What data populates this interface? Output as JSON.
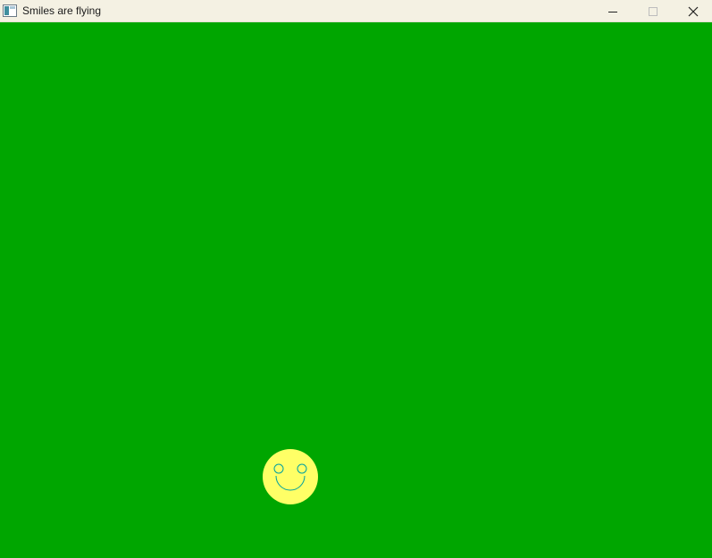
{
  "window": {
    "title": "Smiles are flying"
  },
  "icons": {
    "app": "app-window-icon",
    "minimize": "minimize-icon",
    "maximize": "maximize-icon",
    "close": "close-icon",
    "sprite": "smiley-face-icon"
  },
  "colors": {
    "background": "#00a600",
    "titlebar": "#f4f1e3",
    "smiley_fill": "#ffff66",
    "smiley_features": "#00a0a0"
  }
}
